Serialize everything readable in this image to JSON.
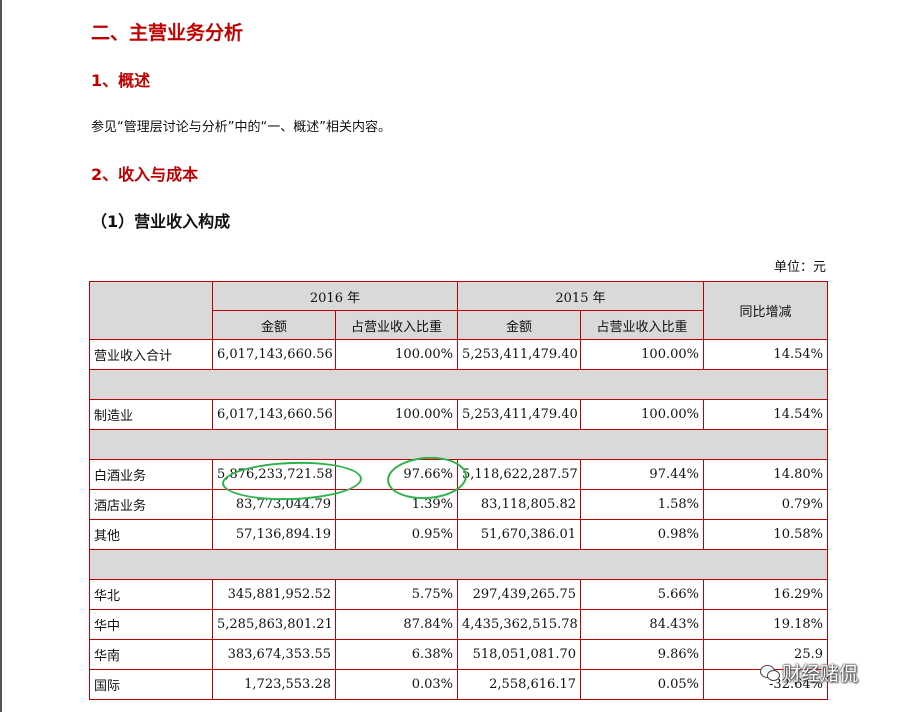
{
  "headings": {
    "section": "二、主营业务分析",
    "overview": "1、概述",
    "revenue_cost": "2、收入与成本",
    "revenue_structure": "（1）营业收入构成"
  },
  "overview_text": "参见“管理层讨论与分析”中的“一、概述”相关内容。",
  "unit": "单位：元",
  "table": {
    "header": {
      "year_2016": "2016 年",
      "year_2015": "2015 年",
      "yoy": "同比增减",
      "amount_2016": "金额",
      "ratio_2016": "占营业收入比重",
      "amount_2015": "金额",
      "ratio_2015": "占营业收入比重"
    },
    "total": {
      "label": "营业收入合计",
      "amt2016": "6,017,143,660.56",
      "pct2016": "100.00%",
      "amt2015": "5,253,411,479.40",
      "pct2015": "100.00%",
      "yoy": "14.54%"
    },
    "manufacturing": {
      "label": "制造业",
      "amt2016": "6,017,143,660.56",
      "pct2016": "100.00%",
      "amt2015": "5,253,411,479.40",
      "pct2015": "100.00%",
      "yoy": "14.54%"
    },
    "products": [
      {
        "label": "白酒业务",
        "amt2016": "5,876,233,721.58",
        "pct2016": "97.66%",
        "amt2015": "5,118,622,287.57",
        "pct2015": "97.44%",
        "yoy": "14.80%"
      },
      {
        "label": "酒店业务",
        "amt2016": "83,773,044.79",
        "pct2016": "1.39%",
        "amt2015": "83,118,805.82",
        "pct2015": "1.58%",
        "yoy": "0.79%"
      },
      {
        "label": "其他",
        "amt2016": "57,136,894.19",
        "pct2016": "0.95%",
        "amt2015": "51,670,386.01",
        "pct2015": "0.98%",
        "yoy": "10.58%"
      }
    ],
    "regions": [
      {
        "label": "华北",
        "amt2016": "345,881,952.52",
        "pct2016": "5.75%",
        "amt2015": "297,439,265.75",
        "pct2015": "5.66%",
        "yoy": "16.29%"
      },
      {
        "label": "华中",
        "amt2016": "5,285,863,801.21",
        "pct2016": "87.84%",
        "amt2015": "4,435,362,515.78",
        "pct2015": "84.43%",
        "yoy": "19.18%"
      },
      {
        "label": "华南",
        "amt2016": "383,674,353.55",
        "pct2016": "6.38%",
        "amt2015": "518,051,081.70",
        "pct2015": "9.86%",
        "yoy": "25.9"
      },
      {
        "label": "国际",
        "amt2016": "1,723,553.28",
        "pct2016": "0.03%",
        "amt2015": "2,558,616.17",
        "pct2015": "0.05%",
        "yoy": "-32.64%"
      }
    ]
  },
  "watermark": {
    "text": "财经赌侃",
    "icon": "wechat-icon"
  },
  "colors": {
    "heading": "#c00000",
    "table_border": "#c00000",
    "header_fill": "#d9d9d9",
    "annotation": "#2db34a"
  }
}
